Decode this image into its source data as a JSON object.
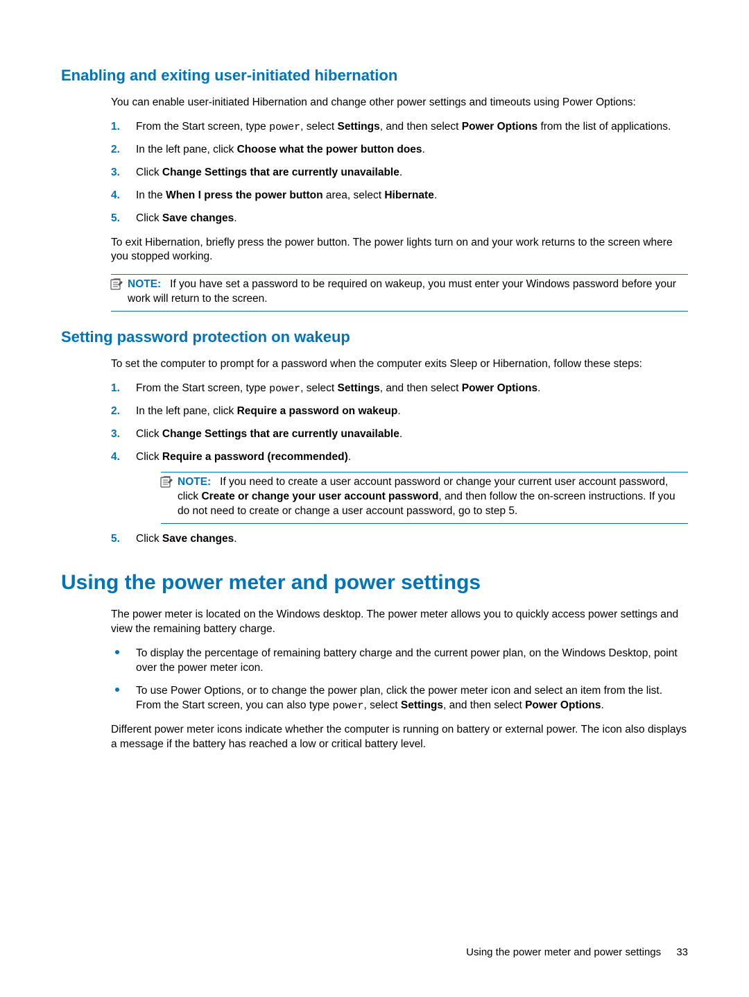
{
  "section1": {
    "heading": "Enabling and exiting user-initiated hibernation",
    "intro": "You can enable user-initiated Hibernation and change other power settings and timeouts using Power Options:",
    "steps": {
      "s1": {
        "num": "1.",
        "p1": "From the Start screen, type ",
        "code": "power",
        "p2": ", select ",
        "b1": "Settings",
        "p3": ", and then select ",
        "b2": "Power Options",
        "p4": " from the list of applications."
      },
      "s2": {
        "num": "2.",
        "p1": "In the left pane, click ",
        "b1": "Choose what the power button does",
        "p2": "."
      },
      "s3": {
        "num": "3.",
        "p1": "Click ",
        "b1": "Change Settings that are currently unavailable",
        "p2": "."
      },
      "s4": {
        "num": "4.",
        "p1": "In the ",
        "b1": "When I press the power button",
        "p2": " area, select ",
        "b2": "Hibernate",
        "p3": "."
      },
      "s5": {
        "num": "5.",
        "p1": "Click ",
        "b1": "Save changes",
        "p2": "."
      }
    },
    "after": "To exit Hibernation, briefly press the power button. The power lights turn on and your work returns to the screen where you stopped working.",
    "note": {
      "label": "NOTE:",
      "text": "If you have set a password to be required on wakeup, you must enter your Windows password before your work will return to the screen."
    }
  },
  "section2": {
    "heading": "Setting password protection on wakeup",
    "intro": "To set the computer to prompt for a password when the computer exits Sleep or Hibernation, follow these steps:",
    "steps": {
      "s1": {
        "num": "1.",
        "p1": "From the Start screen, type ",
        "code": "power",
        "p2": ", select ",
        "b1": "Settings",
        "p3": ", and then select ",
        "b2": "Power Options",
        "p4": "."
      },
      "s2": {
        "num": "2.",
        "p1": "In the left pane, click ",
        "b1": "Require a password on wakeup",
        "p2": "."
      },
      "s3": {
        "num": "3.",
        "p1": "Click ",
        "b1": "Change Settings that are currently unavailable",
        "p2": "."
      },
      "s4": {
        "num": "4.",
        "p1": "Click ",
        "b1": "Require a password (recommended)",
        "p2": "."
      },
      "s5": {
        "num": "5.",
        "p1": "Click ",
        "b1": "Save changes",
        "p2": "."
      }
    },
    "innerNote": {
      "label": "NOTE:",
      "p1": "If you need to create a user account password or change your current user account password, click ",
      "b1": "Create or change your user account password",
      "p2": ", and then follow the on-screen instructions. If you do not need to create or change a user account password, go to step 5."
    }
  },
  "section3": {
    "heading": "Using the power meter and power settings",
    "intro": "The power meter is located on the Windows desktop. The power meter allows you to quickly access power settings and view the remaining battery charge.",
    "bullets": {
      "b1": "To display the percentage of remaining battery charge and the current power plan, on the Windows Desktop, point over the power meter icon.",
      "b2": {
        "p1": "To use Power Options, or to change the power plan, click the power meter icon and select an item from the list. From the Start screen, you can also type ",
        "code": "power",
        "p2": ", select ",
        "b1": "Settings",
        "p3": ", and then select ",
        "b2": "Power Options",
        "p4": "."
      }
    },
    "after": "Different power meter icons indicate whether the computer is running on battery or external power. The icon also displays a message if the battery has reached a low or critical battery level."
  },
  "footer": {
    "text": "Using the power meter and power settings",
    "page": "33"
  }
}
